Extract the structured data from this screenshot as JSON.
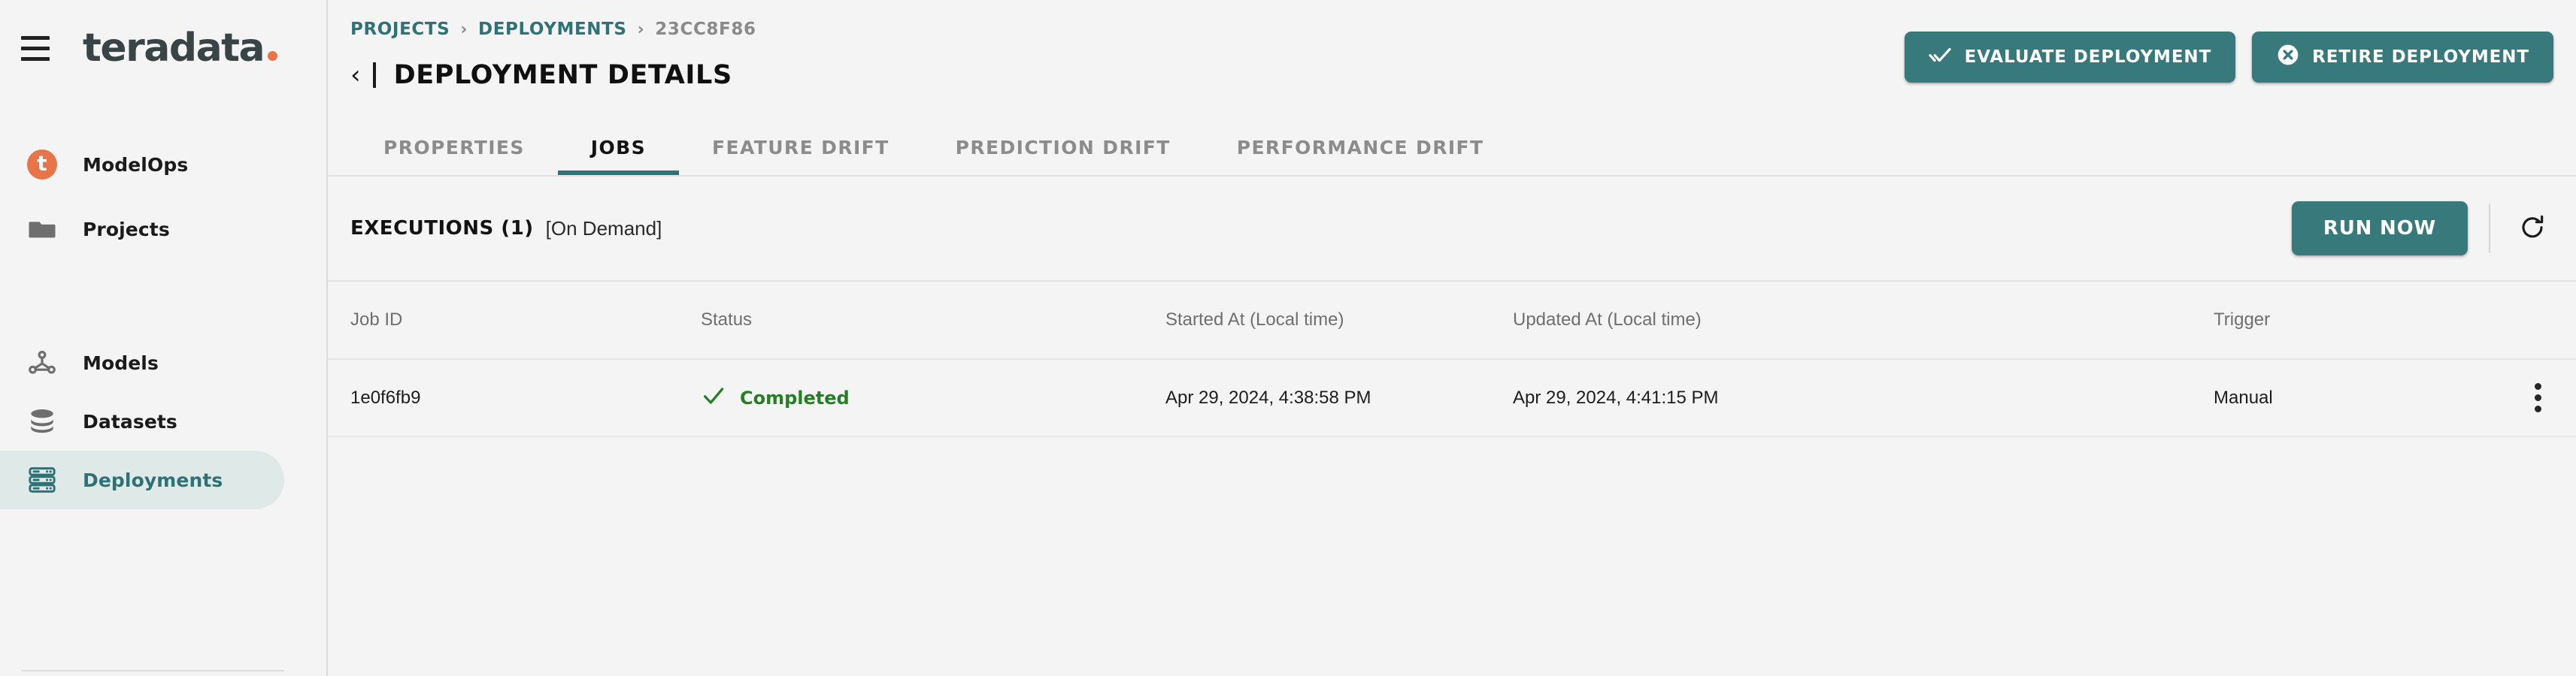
{
  "brand": {
    "name": "teradata",
    "menu_icon": "hamburger-menu-icon"
  },
  "sidebar": {
    "items": [
      {
        "label": "ModelOps",
        "icon": "teradata-t-badge-icon",
        "active": false
      },
      {
        "label": "Projects",
        "icon": "folder-icon",
        "active": false
      },
      {
        "label": "Models",
        "icon": "model-graph-icon",
        "active": false
      },
      {
        "label": "Datasets",
        "icon": "database-stack-icon",
        "active": false
      },
      {
        "label": "Deployments",
        "icon": "server-rack-icon",
        "active": true
      }
    ]
  },
  "header": {
    "breadcrumb": [
      {
        "label": "PROJECTS",
        "type": "link"
      },
      {
        "label": "DEPLOYMENTS",
        "type": "link"
      },
      {
        "label": "23CC8F86",
        "type": "current"
      }
    ],
    "breadcrumb_separator": "›",
    "back_icon": "chevron-left-icon",
    "title": "DEPLOYMENT DETAILS",
    "actions": [
      {
        "label": "EVALUATE DEPLOYMENT",
        "icon": "double-check-icon"
      },
      {
        "label": "RETIRE DEPLOYMENT",
        "icon": "circle-x-icon"
      }
    ]
  },
  "tabs": [
    {
      "label": "PROPERTIES",
      "active": false
    },
    {
      "label": "JOBS",
      "active": true
    },
    {
      "label": "FEATURE DRIFT",
      "active": false
    },
    {
      "label": "PREDICTION DRIFT",
      "active": false
    },
    {
      "label": "PERFORMANCE DRIFT",
      "active": false
    }
  ],
  "executions": {
    "title": "EXECUTIONS (1)",
    "subtitle": "[On Demand]",
    "run_now_label": "RUN NOW",
    "refresh_icon": "refresh-icon"
  },
  "table": {
    "columns": [
      "Job ID",
      "Status",
      "Started At (Local time)",
      "Updated At (Local time)",
      "Trigger"
    ],
    "rows": [
      {
        "job_id": "1e0f6fb9",
        "status": "Completed",
        "status_icon": "check-icon",
        "started_at": "Apr 29, 2024, 4:38:58 PM",
        "updated_at": "Apr 29, 2024, 4:41:15 PM",
        "trigger": "Manual",
        "menu_icon": "kebab-menu-icon"
      }
    ]
  },
  "colors": {
    "brand_teal": "#38797c",
    "brand_orange": "#e8744a",
    "link_teal": "#2f7275",
    "active_nav_bg": "#dfe9e8",
    "status_green": "#258025",
    "page_bg": "#f4f4f4"
  }
}
